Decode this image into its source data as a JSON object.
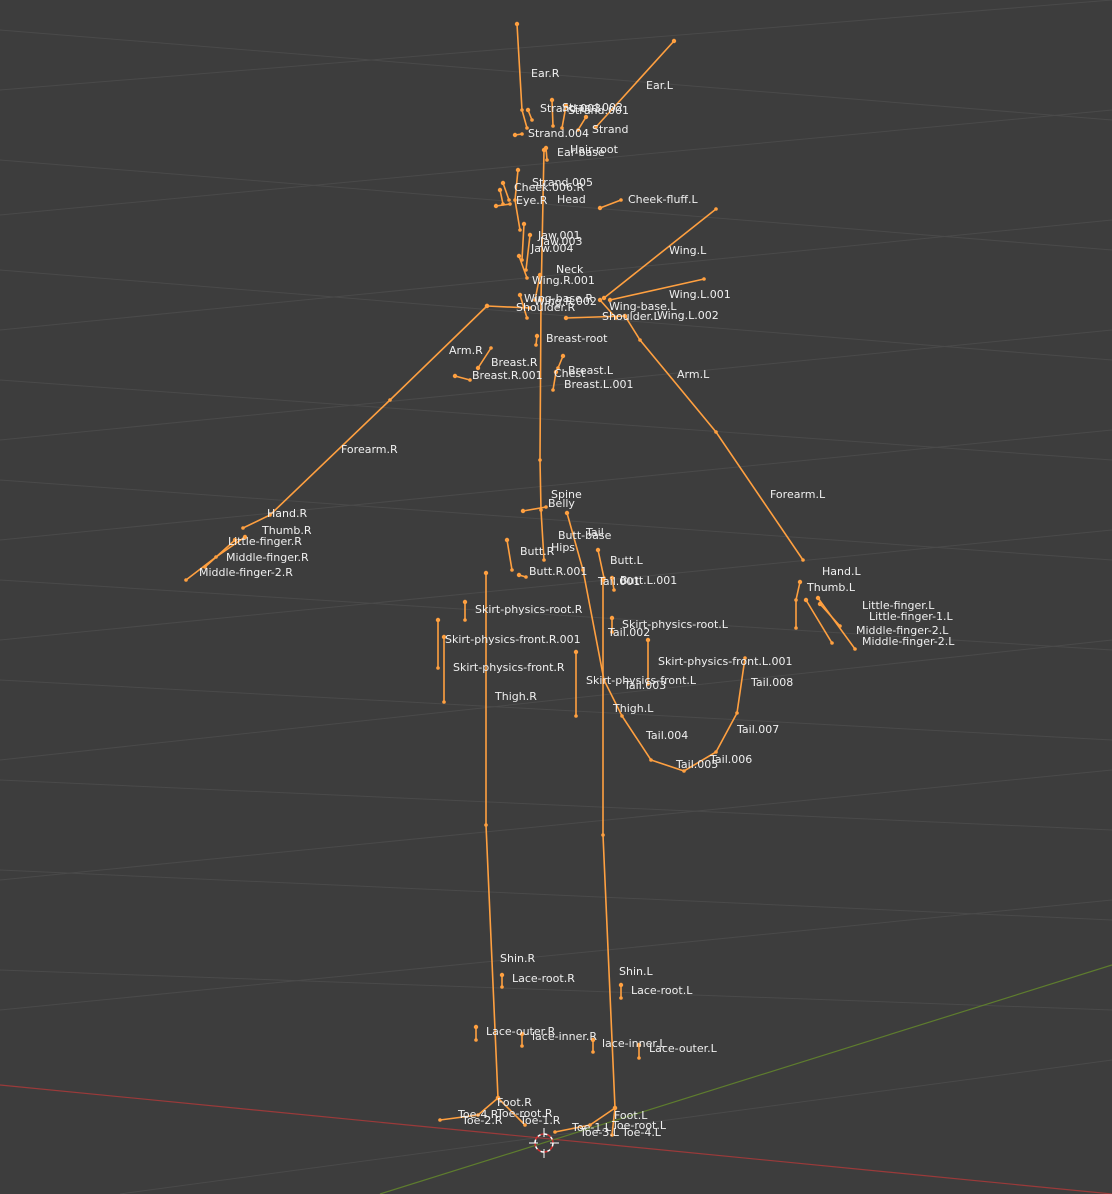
{
  "scene": {
    "background": "#3d3d3d",
    "bone_color": "#ffa040",
    "label_color": "#f0f0f0",
    "x_axis_color": "#9b3a3a",
    "y_axis_color": "#5e7d2e"
  },
  "bone_names": [
    "Ear.R",
    "Ear.L",
    "Strand.003",
    "Strand.002",
    "Strand.001",
    "Strand",
    "Strand.004",
    "Hair-root",
    "Ear-base",
    "Strand.005",
    "Cheek.006.R",
    "Eye.R",
    "Head",
    "Cheek-fluff.L",
    "Jaw.001",
    "Jaw.003",
    "Jaw.004",
    "Wing.L",
    "Neck",
    "Wing.R.001",
    "Wing.L.001",
    "Wing-base.R",
    "Wing.R.002",
    "Wing-base.L",
    "Shoulder.R",
    "Shoulder.L",
    "Wing.L.002",
    "Breast-root",
    "Arm.R",
    "Breast.R",
    "Breast.L",
    "Breast.R.001",
    "Chest",
    "Breast.L.001",
    "Arm.L",
    "Forearm.R",
    "Forearm.L",
    "Spine",
    "Belly",
    "Hand.R",
    "Thumb.R",
    "Tail",
    "Butt-base",
    "Little-finger.R",
    "Butt.R",
    "Hips",
    "Butt.L",
    "Middle-finger.R",
    "Middle-finger-2.R",
    "Butt.R.001",
    "Tail.001",
    "Butt.L.001",
    "Hand.L",
    "Thumb.L",
    "Little-finger.L",
    "Little-finger-1.L",
    "Middle-finger-2.L",
    "Middle-finger-2.L",
    "Skirt-physics-root.R",
    "Skirt-physics-root.L",
    "Tail.002",
    "Skirt-physics-front.R.001",
    "Skirt-physics-front.L.001",
    "Skirt-physics-front.R",
    "Skirt-physics-front.L",
    "Tail.003",
    "Tail.008",
    "Thigh.R",
    "Thigh.L",
    "Tail.007",
    "Tail.004",
    "Tail.006",
    "Tail.005",
    "Shin.R",
    "Shin.L",
    "Lace-root.R",
    "Lace-root.L",
    "Lace-outer.R",
    "lace-inner.R",
    "lace-inner.L",
    "Lace-outer.L",
    "Foot.R",
    "Toe-4.R",
    "Toe-root.R",
    "Toe-1.R",
    "Toe-2.R",
    "Foot.L",
    "Toe-1.L",
    "Toe-root.L",
    "Toe-4.L",
    "Toe-3.L"
  ]
}
